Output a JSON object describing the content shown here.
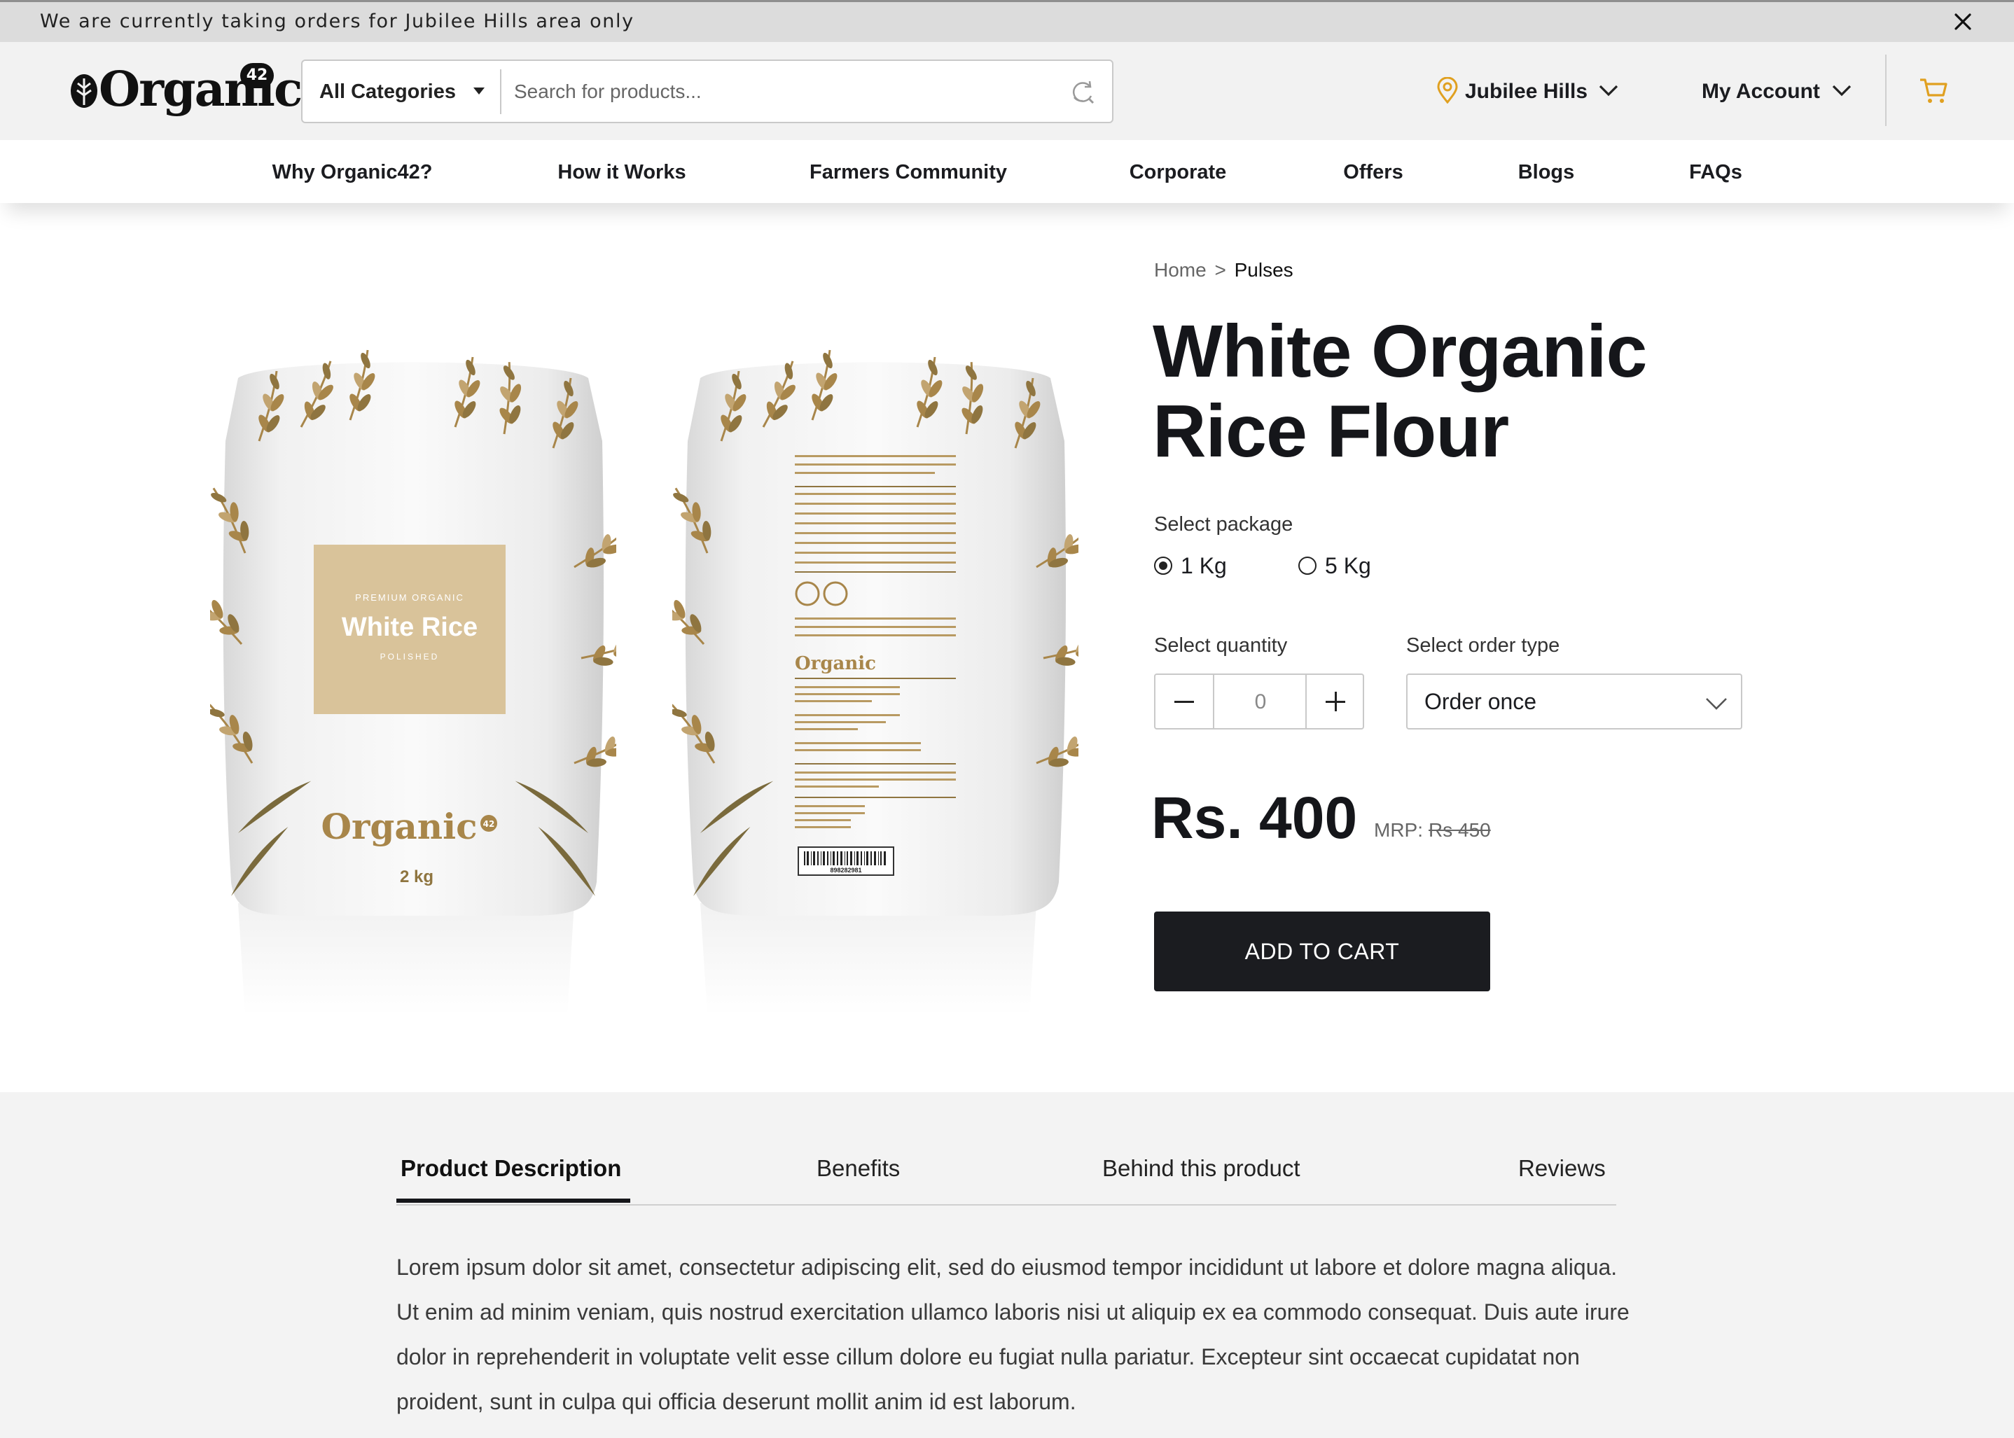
{
  "announcement": {
    "text": "We are currently taking orders for Jubilee Hills area only"
  },
  "header": {
    "logo_text": "Organic",
    "logo_badge": "42",
    "category_label": "All Categories",
    "search_placeholder": "Search for products...",
    "location": "Jubilee Hills",
    "account": "My Account"
  },
  "nav": {
    "items": [
      {
        "label": "Why Organic42?"
      },
      {
        "label": "How it Works"
      },
      {
        "label": "Farmers Community"
      },
      {
        "label": "Corporate"
      },
      {
        "label": "Offers"
      },
      {
        "label": "Blogs"
      },
      {
        "label": "FAQs"
      }
    ]
  },
  "product": {
    "breadcrumb": {
      "home": "Home",
      "separator": ">",
      "current": "Pulses"
    },
    "title_line1": "White Organic",
    "title_line2": "Rice Flour",
    "package_label": "Select package",
    "packages": [
      {
        "label": "1 Kg",
        "selected": true
      },
      {
        "label": "5 Kg",
        "selected": false
      }
    ],
    "quantity_label": "Select quantity",
    "quantity_value": "0",
    "order_type_label": "Select order type",
    "order_type_value": "Order once",
    "price": "Rs. 400",
    "mrp_label": "MRP:",
    "mrp_value": "Rs 450",
    "add_to_cart": "ADD TO CART",
    "bag_front": {
      "label_small": "PREMIUM ORGANIC",
      "label_title": "White Rice",
      "label_sub": "POLISHED",
      "brand": "Organic",
      "badge": "42",
      "weight": "2 kg"
    },
    "bag_back": {
      "brand": "Organic",
      "barcode": "898282981"
    }
  },
  "details": {
    "tabs": [
      {
        "label": "Product Description",
        "active": true
      },
      {
        "label": "Benefits",
        "active": false
      },
      {
        "label": "Behind this product",
        "active": false
      },
      {
        "label": "Reviews",
        "active": false
      }
    ],
    "description": "Lorem ipsum dolor sit amet, consectetur adipiscing elit, sed do eiusmod tempor incididunt ut labore et dolore magna aliqua. Ut enim ad minim veniam, quis nostrud exercitation ullamco laboris nisi ut aliquip ex ea commodo consequat. Duis aute irure dolor in reprehenderit in voluptate velit esse cillum dolore eu fugiat nulla pariatur. Excepteur sint occaecat cupidatat non proident, sunt in culpa qui officia deserunt mollit anim id est laborum."
  },
  "colors": {
    "accent": "#e0a020",
    "dark": "#1b1c20",
    "bag_gold": "#a8864a",
    "label_beige": "#d9c39a"
  },
  "icons": [
    "close-icon",
    "search-icon",
    "location-pin-icon",
    "chevron-down-icon",
    "cart-icon",
    "leaf-icon"
  ]
}
